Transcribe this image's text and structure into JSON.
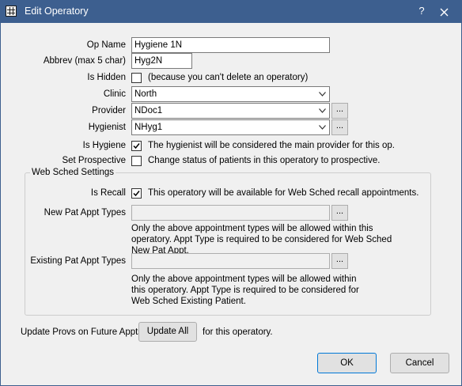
{
  "window": {
    "title": "Edit Operatory",
    "help": "?"
  },
  "fields": {
    "op_name": {
      "label": "Op Name",
      "value": "Hygiene 1N"
    },
    "abbrev": {
      "label": "Abbrev (max 5 char)",
      "value": "Hyg2N"
    },
    "is_hidden": {
      "label": "Is Hidden",
      "checked": false,
      "note": "(because you can't delete an operatory)"
    },
    "clinic": {
      "label": "Clinic",
      "value": "North"
    },
    "provider": {
      "label": "Provider",
      "value": "NDoc1",
      "picker": "..."
    },
    "hygienist": {
      "label": "Hygienist",
      "value": "NHyg1",
      "picker": "..."
    },
    "is_hygiene": {
      "label": "Is Hygiene",
      "checked": true,
      "note": "The hygienist will be considered the main provider for this op."
    },
    "set_prospective": {
      "label": "Set Prospective",
      "checked": false,
      "note": "Change status of patients in this operatory to prospective."
    }
  },
  "web_sched": {
    "title": "Web Sched Settings",
    "is_recall": {
      "label": "Is Recall",
      "checked": true,
      "note": "This operatory will be available for Web Sched recall appointments."
    },
    "new_pat": {
      "label": "New Pat Appt Types",
      "value": "",
      "picker": "...",
      "note": "Only the above appointment types will be allowed within this operatory. Appt Type is required to be considered for Web Sched New Pat Appt."
    },
    "existing_pat": {
      "label": "Existing Pat Appt Types",
      "value": "",
      "picker": "...",
      "note": "Only the above appointment types will be allowed within this operatory.  Appt Type is required to be considered for Web Sched Existing Patient."
    }
  },
  "update_provs": {
    "label": "Update Provs on Future Appts",
    "button": "Update All",
    "suffix": "for this operatory."
  },
  "buttons": {
    "ok": "OK",
    "cancel": "Cancel"
  },
  "colors": {
    "titlebar": "#3d5f8f",
    "client": "#f0f0f0",
    "default_button_border": "#0078d7"
  },
  "icons": {
    "app": "grid-icon",
    "close": "close-icon",
    "dropdown": "chevron-down-icon",
    "check": "check-icon"
  }
}
